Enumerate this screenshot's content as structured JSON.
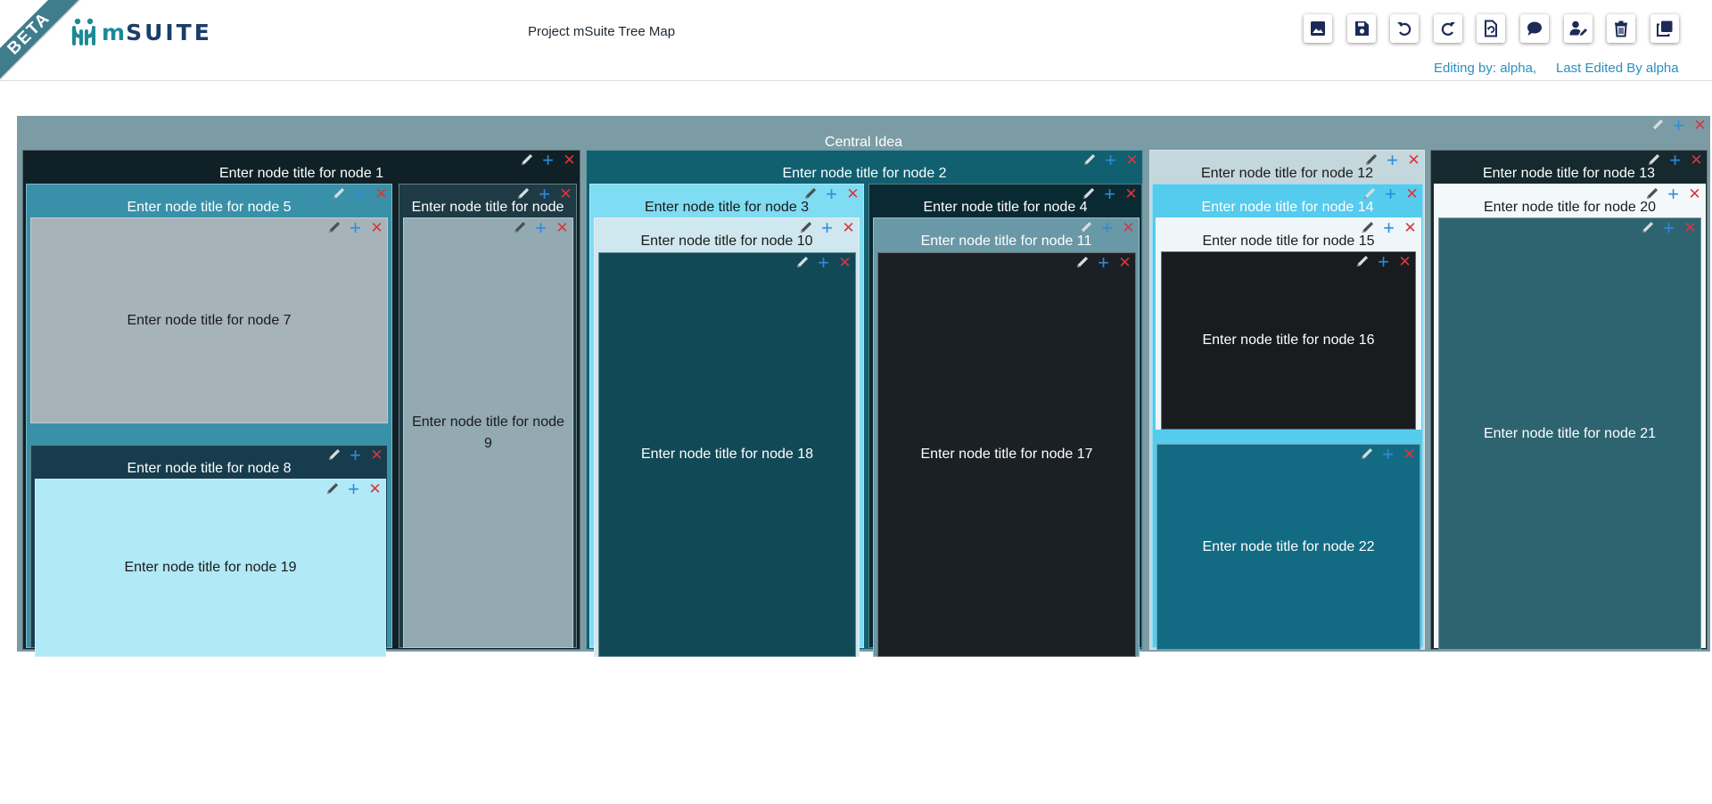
{
  "app": {
    "beta_label": "BETA",
    "logo_text": "SUITE",
    "logo_prefix": "m",
    "project_title": "Project mSuite Tree Map",
    "editing_by": "Editing by: alpha,",
    "last_edited": "Last Edited By alpha"
  },
  "toolbar": {
    "buttons": [
      {
        "icon": "image-icon",
        "label": "Insert image"
      },
      {
        "icon": "save-icon",
        "label": "Save"
      },
      {
        "icon": "undo-icon",
        "label": "Undo"
      },
      {
        "icon": "redo-icon",
        "label": "Redo"
      },
      {
        "icon": "restore-icon",
        "label": "Restore"
      },
      {
        "icon": "comment-icon",
        "label": "Comments"
      },
      {
        "icon": "user-edit-icon",
        "label": "Edit users"
      },
      {
        "icon": "trash-icon",
        "label": "Delete"
      },
      {
        "icon": "copy-icon",
        "label": "Duplicate"
      }
    ]
  },
  "tree": {
    "root": "Central Idea",
    "nodes": {
      "n1": "Enter node title for node 1",
      "n2": "Enter node title for node 2",
      "n3": "Enter node title for node 3",
      "n4": "Enter node title for node 4",
      "n5": "Enter node title for node 5",
      "n6": "Enter node title for node",
      "n7": "Enter node title for node 7",
      "n8": "Enter node title for node 8",
      "n9": "Enter node title for node 9",
      "n10": "Enter node title for node 10",
      "n11": "Enter node title for node 11",
      "n12": "Enter node title for node 12",
      "n13": "Enter node title for node 13",
      "n14": "Enter node title for node 14",
      "n15": "Enter node title for node 15",
      "n16": "Enter node title for node 16",
      "n17": "Enter node title for node 17",
      "n18": "Enter node title for node 18",
      "n19": "Enter node title for node 19",
      "n20": "Enter node title for node 20",
      "n21": "Enter node title for node 21",
      "n22": "Enter node title for node 22"
    },
    "colors": {
      "root": "#7b9ca5",
      "n1": "#0f2126",
      "n2": "#106070",
      "n3": "#7fdcf2",
      "n4": "#0a2a33",
      "n5": "#3891a8",
      "n6": "#1e3b45",
      "n7": "#a6b3b8",
      "n8": "#173c4d",
      "n9": "#93aab3",
      "n10": "#cfe7ee",
      "n11": "#6998a6",
      "n12": "#c3d7dd",
      "n13": "#15292e",
      "n14": "#55cbee",
      "n15": "#eef6f9",
      "n16": "#181c1f",
      "n17": "#1b2024",
      "n18": "#124957",
      "n19": "#b1e9f6",
      "n20": "#f3f9fb",
      "n21": "#2e6470",
      "n22": "#136b83"
    }
  }
}
